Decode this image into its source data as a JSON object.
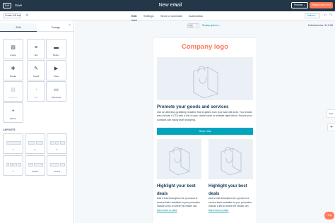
{
  "topbar": {
    "exit_label": "Exit",
    "save_label": "Save",
    "email_title": "New email",
    "preview_label": "Preview",
    "review_label": "Review and send"
  },
  "subbar": {
    "create_ab_label": "Create A/B test",
    "tabs": [
      {
        "label": "Edit",
        "active": true
      },
      {
        "label": "Settings",
        "active": false
      },
      {
        "label": "Send or schedule",
        "active": false
      },
      {
        "label": "Automation",
        "active": false
      }
    ],
    "actions_label": "Actions"
  },
  "sidebar": {
    "tabs": [
      {
        "label": "Edit",
        "active": true
      },
      {
        "label": "Design",
        "active": false
      }
    ],
    "modules": [
      {
        "label": "Image",
        "icon": "image-icon",
        "glyph": "▨"
      },
      {
        "label": "Text",
        "icon": "text-icon",
        "glyph": "≡"
      },
      {
        "label": "Button",
        "icon": "button-icon",
        "glyph": "▬"
      },
      {
        "label": "Divider",
        "icon": "divider-icon",
        "glyph": "✚"
      },
      {
        "label": "Social",
        "icon": "social-icon",
        "glyph": "✎"
      },
      {
        "label": "Video",
        "icon": "video-icon",
        "glyph": "▶"
      },
      {
        "label": "Blog post",
        "icon": "blog-icon",
        "glyph": "▤"
      },
      {
        "label": "RSS",
        "icon": "rss-icon",
        "glyph": "◔"
      },
      {
        "label": "Payments",
        "icon": "payments-icon",
        "glyph": "▭"
      },
      {
        "label": "Spacer",
        "icon": "spacer-icon",
        "glyph": "+"
      }
    ],
    "layouts_heading": "LAYOUTS",
    "layouts": [
      {
        "label": "1",
        "cols": [
          21
        ]
      },
      {
        "label": "2",
        "cols": [
          10,
          10
        ]
      },
      {
        "label": "3",
        "cols": [
          6,
          6,
          7
        ]
      },
      {
        "label": "4",
        "cols": [
          4,
          4,
          5,
          5
        ]
      },
      {
        "label": "1/3 2/3",
        "cols": [
          7,
          13
        ]
      },
      {
        "label": "2/3 1/3",
        "cols": [
          13,
          7
        ]
      }
    ]
  },
  "canvas": {
    "display_options": "Display options ⌄",
    "estimated_size": "Estimated size: 34.9 KB",
    "right_tab": "Test"
  },
  "email": {
    "logo": "Company logo",
    "heading": "Promote your goods and services",
    "paragraph": "Use an attention-grabbing headline that explains how your sale will work. You should also include a CTA with a link to your online store or website right below. Ensure your contacts can easily start shopping.",
    "cta_label": "Shop now",
    "columns": [
      {
        "heading": "Highlight your best deals",
        "text": "Add a brief description for a product or service that's available in your promotion. Include a link to where the reader can ",
        "link": "learn more or start."
      },
      {
        "heading": "Highlight your best deals",
        "text": "Add a brief description for a product or service that's available in your promotion. Include a link to where the reader can ",
        "link": "learn more or start."
      }
    ]
  },
  "help_label": "Help",
  "colors": {
    "topbar": "#243748",
    "accent_orange": "#ff7a59",
    "cta_teal": "#00a4bd",
    "link": "#0091ae"
  }
}
